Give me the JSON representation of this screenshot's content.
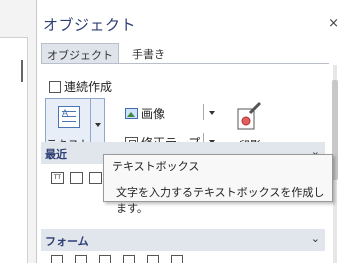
{
  "panel": {
    "title": "オブジェクト",
    "close_glyph": "×",
    "tabs": [
      {
        "label": "オブジェクト",
        "active": true
      },
      {
        "label": "手書き",
        "active": false
      }
    ]
  },
  "options": {
    "continuous_label": "連続作成",
    "continuous_checked": false
  },
  "tools": {
    "textbox_label": "テキスト",
    "image_label": "画像",
    "tape_label": "修正テープ",
    "stamp_label": "印影"
  },
  "sections": {
    "recent_label": "最近",
    "form_label": "フォーム",
    "chevron_glyph": "⌄"
  },
  "tooltip": {
    "title": "テキストボックス",
    "description": "文字を入力するテキストボックスを作成します。"
  },
  "icons": {
    "textbox": "textbox-icon",
    "image": "image-icon",
    "tape": "correction-tape-icon",
    "stamp": "stamp-icon",
    "close": "close-icon"
  },
  "colors": {
    "accent": "#2e3f73",
    "section_bg": "#e1e5ec",
    "button_bg": "#e8eef7",
    "button_border": "#8fa7c8"
  }
}
